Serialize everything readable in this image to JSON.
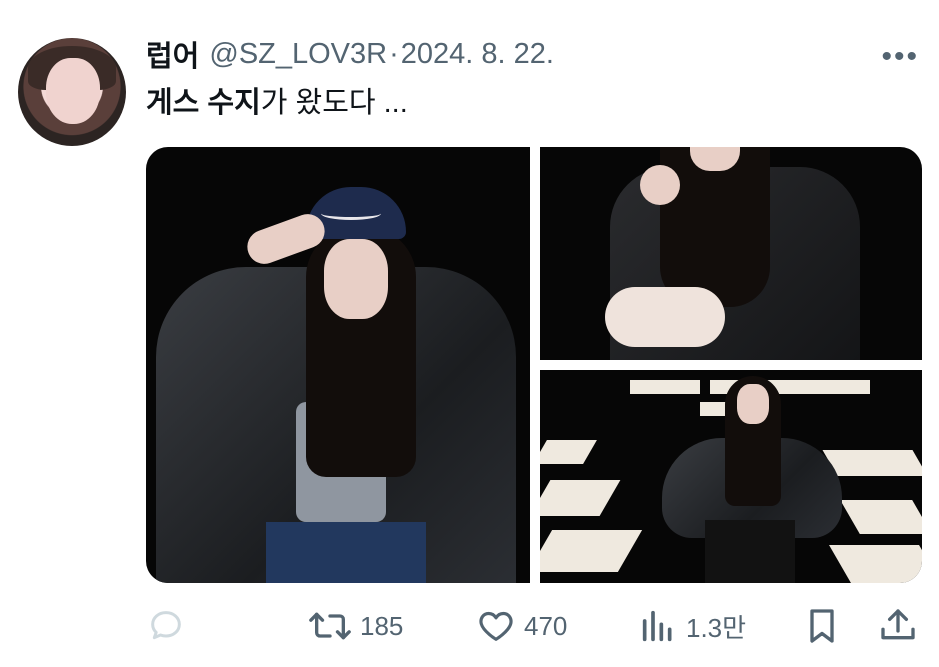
{
  "tweet": {
    "author_name": "럽어",
    "handle": "@SZ_LOV3R",
    "separator": "·",
    "date": "2024. 8. 22.",
    "text_bold": "게스 수지",
    "text_rest": "가 왔도다 ...",
    "more_icon": "more-horizontal-icon"
  },
  "media": {
    "count": 3,
    "background": "#060606"
  },
  "actions": {
    "reply": {
      "icon": "reply-icon",
      "count": ""
    },
    "retweet": {
      "icon": "retweet-icon",
      "count": "185"
    },
    "like": {
      "icon": "heart-icon",
      "count": "470"
    },
    "views": {
      "icon": "views-chart-icon",
      "count": "1.3만"
    },
    "bookmark": {
      "icon": "bookmark-icon"
    },
    "share": {
      "icon": "share-icon"
    }
  },
  "colors": {
    "text_primary": "#0f1419",
    "text_secondary": "#536471",
    "reply_icon_faded": "#cfd9de"
  }
}
